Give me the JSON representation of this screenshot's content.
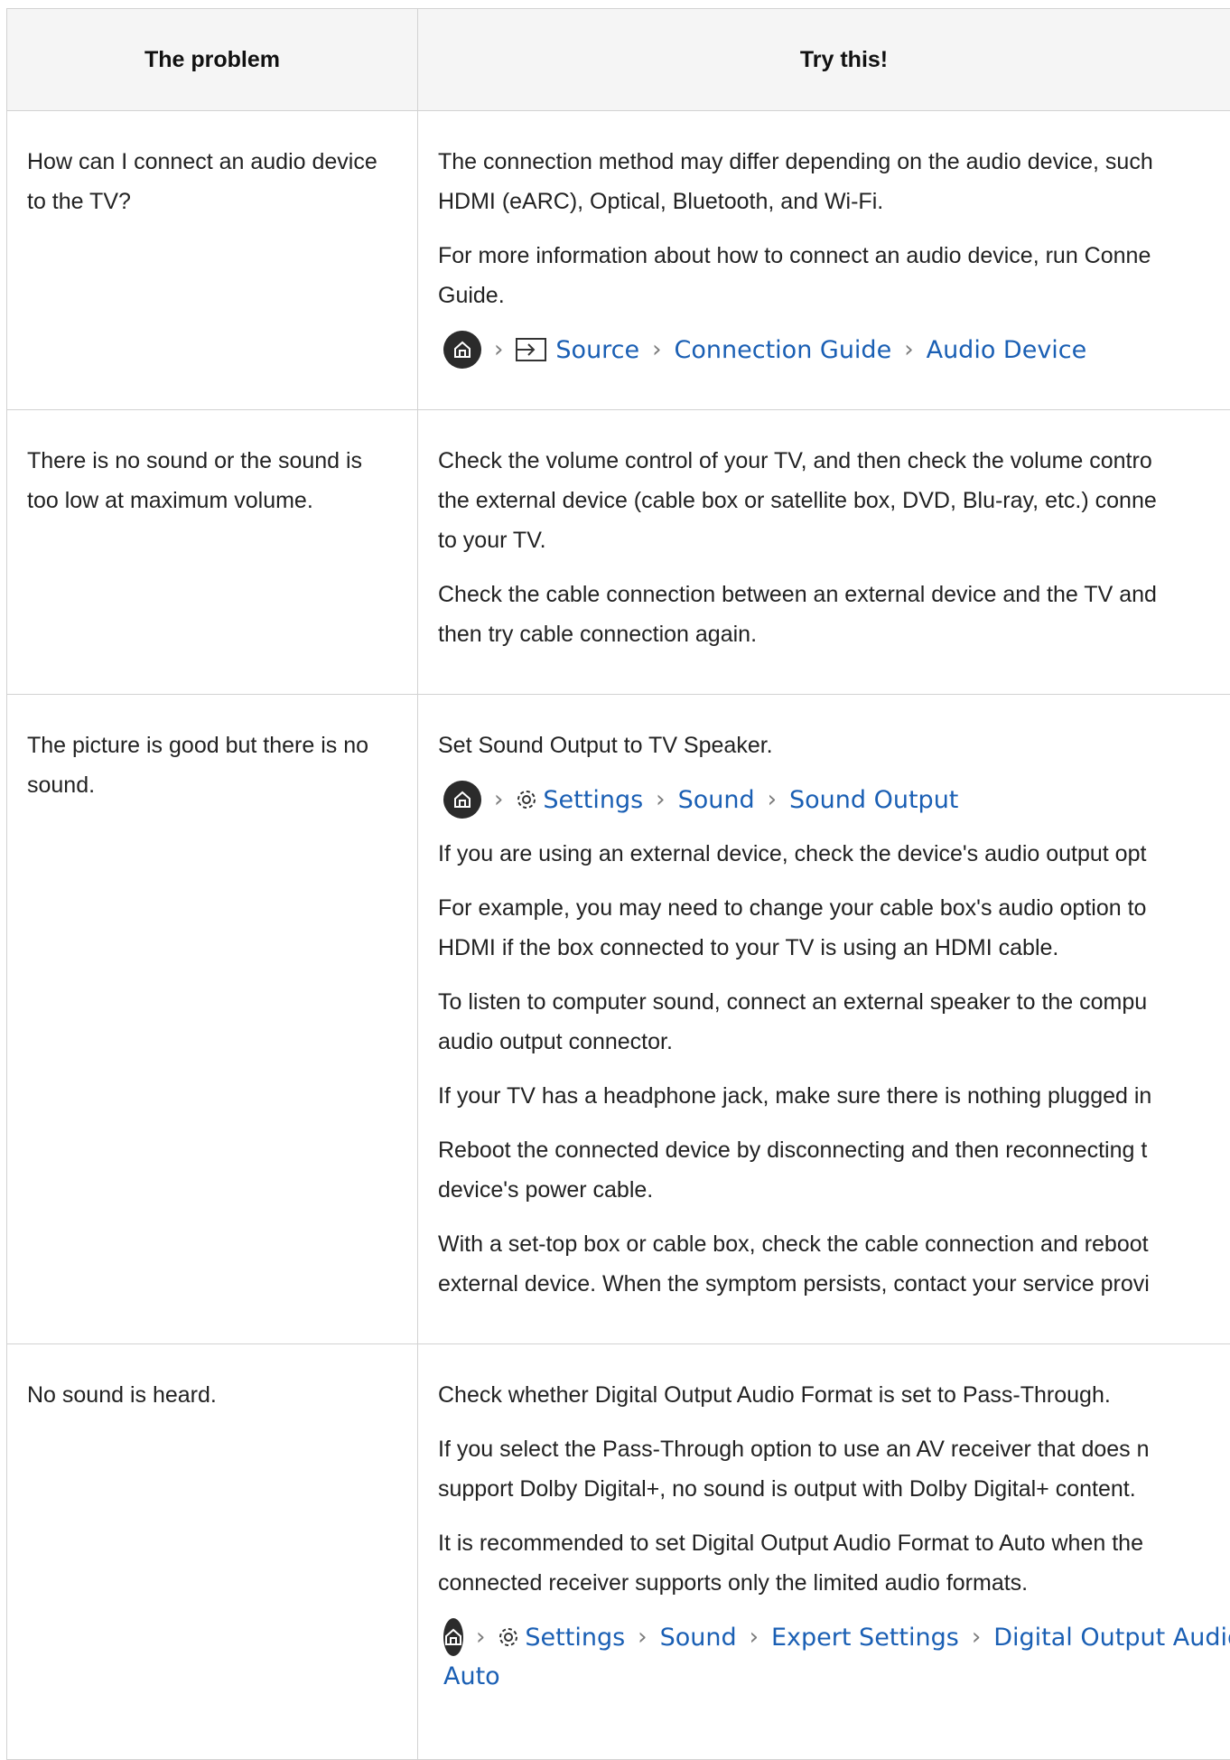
{
  "table": {
    "header_problem": "The problem",
    "header_try": "Try this!"
  },
  "rows": [
    {
      "problem": "How can I connect an audio device to the TV?",
      "p1": "The connection method may differ depending on the audio device, such",
      "p1b": "HDMI (eARC), Optical, Bluetooth, and Wi-Fi.",
      "p2": "For more information about how to connect an audio device, run Conne",
      "p2b": "Guide.",
      "path": [
        "Source",
        "Connection Guide",
        "Audio Device"
      ]
    },
    {
      "problem": "There is no sound or the sound is too low at maximum volume.",
      "p1": "Check the volume control of your TV, and then check the volume contro",
      "p1b": "the external device (cable box or satellite box, DVD, Blu-ray, etc.) conne",
      "p1c": "to your TV.",
      "p2": "Check the cable connection between an external device and the TV and",
      "p2b": "then try cable connection again."
    },
    {
      "problem": "The picture is good but there is no sound.",
      "p1": "Set Sound Output to TV Speaker.",
      "path": [
        "Settings",
        "Sound",
        "Sound Output"
      ],
      "p2": "If you are using an external device, check the device's audio output opt",
      "p3": "For example, you may need to change your cable box's audio option to",
      "p3b": "HDMI if the box connected to your TV is using an HDMI cable.",
      "p4": "To listen to computer sound, connect an external speaker to the compu",
      "p4b": "audio output connector.",
      "p5": "If your TV has a headphone jack, make sure there is nothing plugged in",
      "p6": "Reboot the connected device by disconnecting and then reconnecting t",
      "p6b": "device's power cable.",
      "p7": "With a set-top box or cable box, check the cable connection and reboot",
      "p7b": "external device. When the symptom persists, contact your service provi"
    },
    {
      "problem": "No sound is heard.",
      "p1": "Check whether Digital Output Audio Format is set to Pass-Through.",
      "p2": "If you select the Pass-Through option to use an AV receiver that does n",
      "p2b": "support Dolby Digital+, no sound is output with Dolby Digital+ content.",
      "p3": "It is recommended to set Digital Output Audio Format to Auto when the",
      "p3b": "connected receiver supports only the limited audio formats.",
      "path": [
        "Settings",
        "Sound",
        "Expert Settings",
        "Digital Output Audio For"
      ],
      "path_cont": "Auto"
    }
  ],
  "icons": {
    "home": "home-icon",
    "source": "source-input-icon",
    "settings": "gear-icon",
    "separator": "chevron-right-icon"
  },
  "colors": {
    "link": "#1a5fb4",
    "header_bg": "#f5f5f5",
    "border": "#d2d2d2"
  }
}
